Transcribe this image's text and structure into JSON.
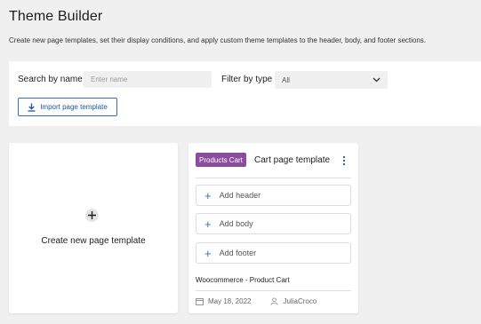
{
  "header": {
    "title": "Theme Builder",
    "subtitle": "Create new page templates, set their display conditions, and apply custom theme templates to the header, body, and footer sections."
  },
  "filters": {
    "search_label": "Search by name",
    "search_placeholder": "Enter name",
    "filter_label": "Filter by type",
    "filter_value": "All",
    "import_label": "Import page template"
  },
  "create_card": {
    "label": "Create new page template"
  },
  "template_card": {
    "badge": "Products Cart",
    "badge_color": "#8c4d9f",
    "title": "Cart page template",
    "sections": [
      {
        "label": "Add header",
        "icon": "plus-icon"
      },
      {
        "label": "Add body",
        "icon": "plus-icon"
      },
      {
        "label": "Add footer",
        "icon": "plus-icon"
      }
    ],
    "source": "Woocommerce - Product Cart",
    "date": "May 18, 2022",
    "author": "JuliaCroco"
  },
  "colors": {
    "accent": "#1f5594",
    "background": "#f0f0f1"
  }
}
